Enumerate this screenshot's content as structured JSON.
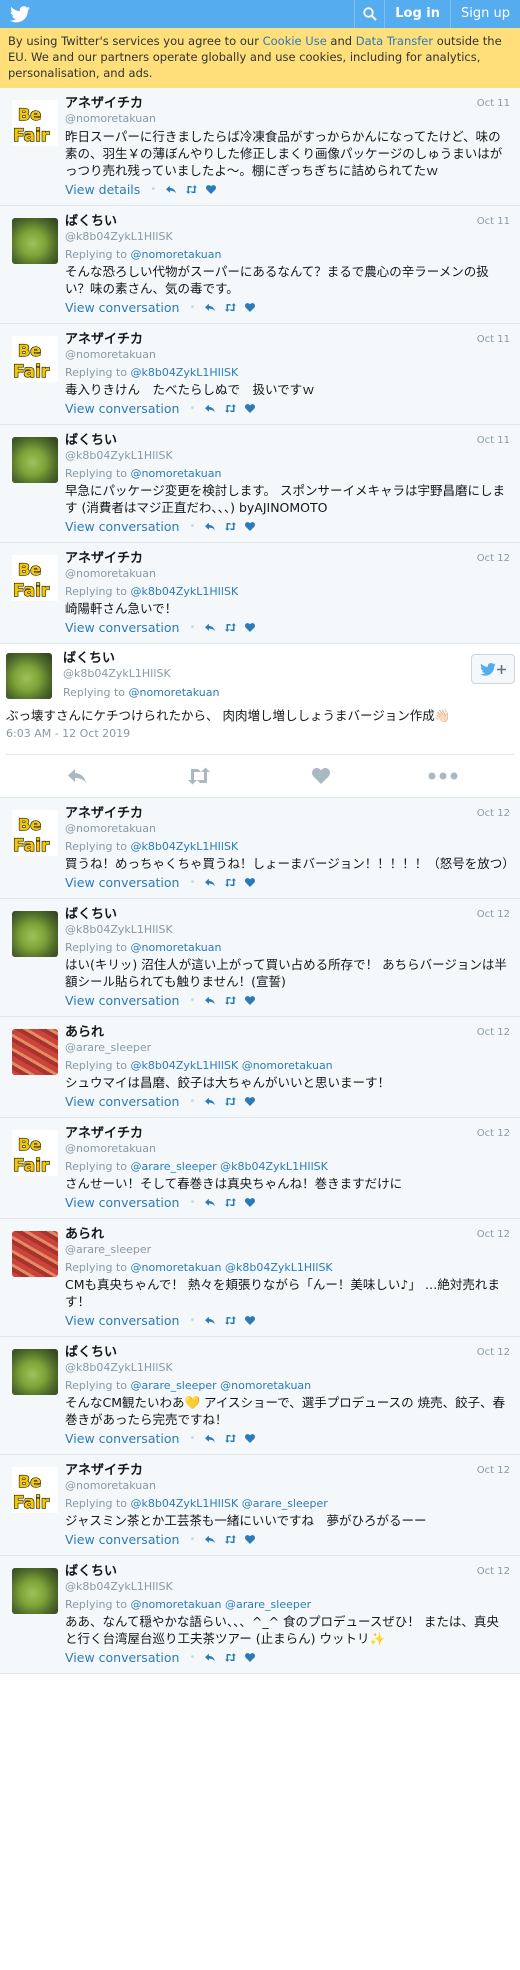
{
  "header": {
    "login_label": "Log in",
    "signup_label": "Sign up"
  },
  "cookie_banner": {
    "text_before": "By using Twitter's services you agree to our ",
    "cookie_link": "Cookie Use",
    "text_mid": " and ",
    "transfer_link": "Data Transfer",
    "text_after": " outside the EU. We and our partners operate globally and use cookies, including for analytics, personalisation, and ads."
  },
  "labels": {
    "view_details": "View details",
    "view_conversation": "View conversation",
    "replying_to": "Replying to"
  },
  "colors": {
    "brand": "#55acee",
    "link": "#2b7bb9",
    "banner": "#fedf7a",
    "muted": "#8899a6"
  },
  "tweets_before": [
    {
      "name": "アネザイチカ",
      "handle": "@nomoretakuan",
      "date": "Oct 11",
      "avatar": "befair",
      "replying": [],
      "text": "昨日スーパーに行きましたらば冷凍食品がすっからかんになってたけど、味の素の、羽生￥の薄ぼんやりした修正しまくり画像パッケージのしゅうまいはがっつり売れ残っていましたよ～。棚にぎっちぎちに詰められてたｗ",
      "link": "View details"
    },
    {
      "name": "ばくちい",
      "handle": "@k8b04ZykL1HIlSK",
      "date": "Oct 11",
      "avatar": "coco",
      "replying": [
        "@nomoretakuan"
      ],
      "text": "そんな恐ろしい代物がスーパーにあるなんて？まるで農心の辛ラーメンの扱い？味の素さん、気の毒です。",
      "link": "View conversation"
    },
    {
      "name": "アネザイチカ",
      "handle": "@nomoretakuan",
      "date": "Oct 11",
      "avatar": "befair",
      "replying": [
        "@k8b04ZykL1HIlSK"
      ],
      "text": "毒入りきけん　たべたらしぬで　扱いですｗ",
      "link": "View conversation"
    },
    {
      "name": "ばくちい",
      "handle": "@k8b04ZykL1HIlSK",
      "date": "Oct 11",
      "avatar": "coco",
      "replying": [
        "@nomoretakuan"
      ],
      "text": "早急にパッケージ変更を検討します。 スポンサーイメキャラは宇野昌磨にします (消費者はマジ正直だわ、、、) byAJINOMOTO",
      "link": "View conversation"
    },
    {
      "name": "アネザイチカ",
      "handle": "@nomoretakuan",
      "date": "Oct 12",
      "avatar": "befair",
      "replying": [
        "@k8b04ZykL1HIlSK"
      ],
      "text": "崎陽軒さん急いで！",
      "link": "View conversation"
    }
  ],
  "main_tweet": {
    "name": "ばくちい",
    "handle": "@k8b04ZykL1HIlSK",
    "replying": "@nomoretakuan",
    "text": "ぶっ壊すさんにケチつけられたから、 肉肉増し増ししょうまバージョン作成👋🏻",
    "timestamp": "6:03 AM - 12 Oct 2019"
  },
  "tweets_after": [
    {
      "name": "アネザイチカ",
      "handle": "@nomoretakuan",
      "date": "Oct 12",
      "avatar": "befair",
      "replying": [
        "@k8b04ZykL1HIlSK"
      ],
      "text": "買うね！めっちゃくちゃ買うね！しょーまバージョン！！！！！（怒号を放つ）",
      "link": "View conversation"
    },
    {
      "name": "ばくちい",
      "handle": "@k8b04ZykL1HIlSK",
      "date": "Oct 12",
      "avatar": "coco",
      "replying": [
        "@nomoretakuan"
      ],
      "text": "はい(キリッ) 沼住人が這い上がって買い占める所存で！ あちらバージョンは半額シール貼られても触りません！(宣誓)",
      "link": "View conversation"
    },
    {
      "name": "あられ",
      "handle": "@arare_sleeper",
      "date": "Oct 12",
      "avatar": "arare",
      "replying": [
        "@k8b04ZykL1HIlSK",
        "@nomoretakuan"
      ],
      "text": "シュウマイは昌磨、餃子は大ちゃんがいいと思いまーす！",
      "link": "View conversation"
    },
    {
      "name": "アネザイチカ",
      "handle": "@nomoretakuan",
      "date": "Oct 12",
      "avatar": "befair",
      "replying": [
        "@arare_sleeper",
        "@k8b04ZykL1HIlSK"
      ],
      "text": "さんせーい！そして春巻きは真央ちゃんね！巻きますだけに",
      "link": "View conversation"
    },
    {
      "name": "あられ",
      "handle": "@arare_sleeper",
      "date": "Oct 12",
      "avatar": "arare",
      "replying": [
        "@nomoretakuan",
        "@k8b04ZykL1HIlSK"
      ],
      "text": "CMも真央ちゃんで！ 熱々を頬張りながら「んー！美味しい♪」 …絶対売れます！",
      "link": "View conversation"
    },
    {
      "name": "ばくちい",
      "handle": "@k8b04ZykL1HIlSK",
      "date": "Oct 12",
      "avatar": "coco",
      "replying": [
        "@arare_sleeper",
        "@nomoretakuan"
      ],
      "text": "そんなCM観たいわあ💛 アイスショーで、選手プロデュースの 焼売、餃子、春巻きがあったら完売ですね！",
      "link": "View conversation"
    },
    {
      "name": "アネザイチカ",
      "handle": "@nomoretakuan",
      "date": "Oct 12",
      "avatar": "befair",
      "replying": [
        "@k8b04ZykL1HIlSK",
        "@arare_sleeper"
      ],
      "text": "ジャスミン茶とか工芸茶も一緒にいいですね　夢がひろがるーー",
      "link": "View conversation"
    },
    {
      "name": "ばくちい",
      "handle": "@k8b04ZykL1HIlSK",
      "date": "Oct 12",
      "avatar": "coco",
      "replying": [
        "@nomoretakuan",
        "@arare_sleeper"
      ],
      "text": "ああ、なんて穏やかな語らい、、、^_^ 食のプロデュースぜひ！ または、真央と行く台湾屋台巡り工夫茶ツアー (止まらん) ウットリ✨",
      "link": "View conversation"
    }
  ]
}
